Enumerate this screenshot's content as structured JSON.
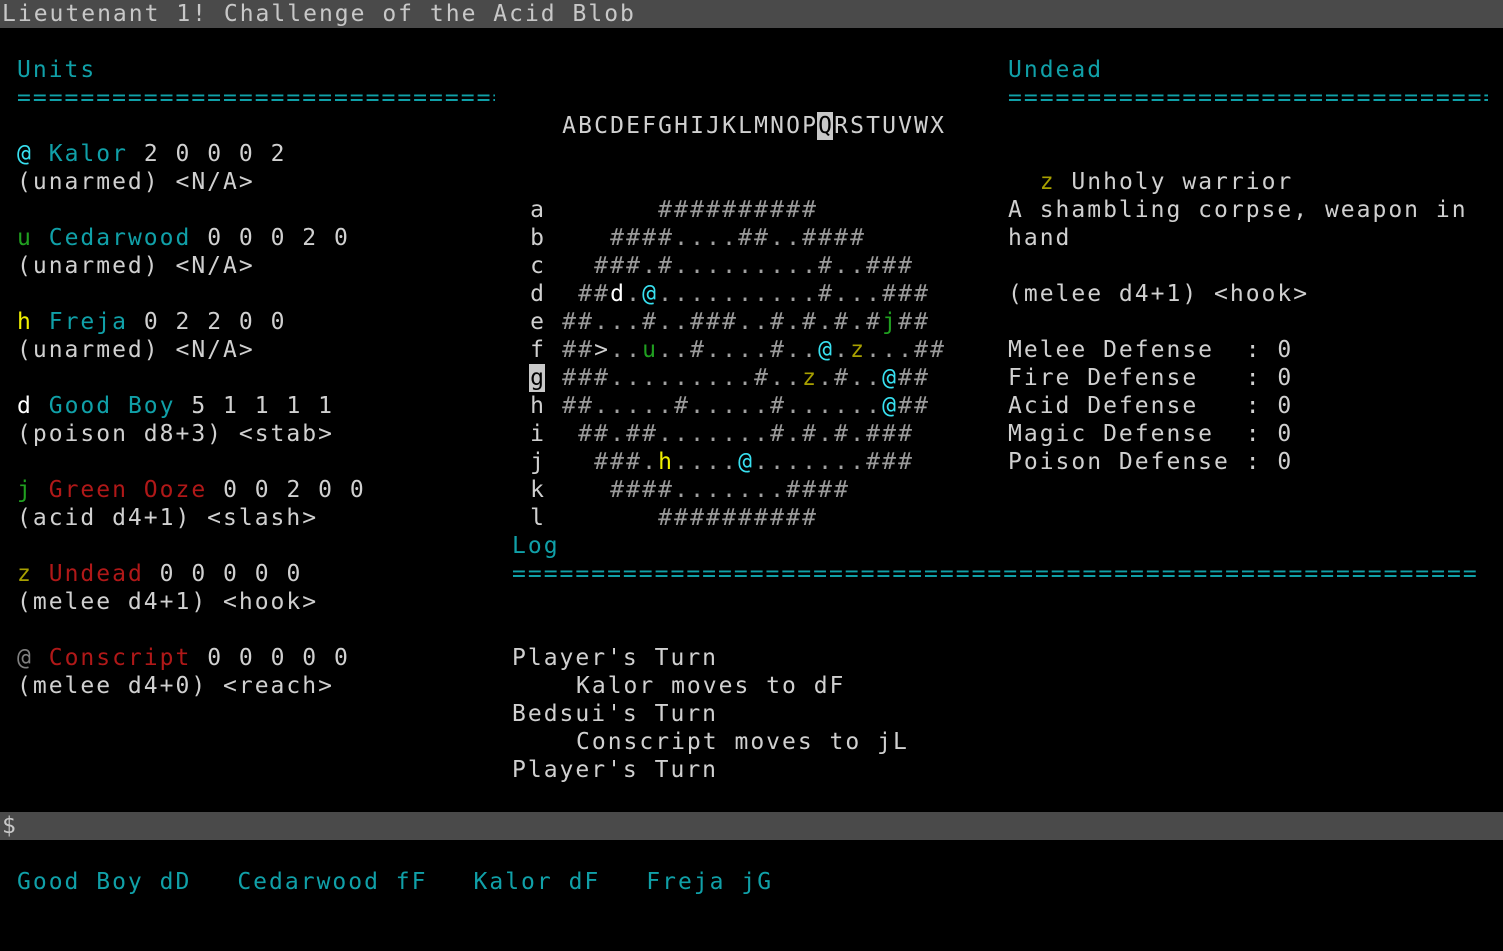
{
  "title": "Lieutenant 1! Challenge of the Acid Blob",
  "colors": {
    "teal": "#10a0a8",
    "cyan": "#38e0f0",
    "yellow": "#f0f000",
    "olive": "#a8a000",
    "green": "#20a020",
    "red": "#b01818",
    "gray": "#808080",
    "white": "#ffffff"
  },
  "units": {
    "heading": "Units",
    "rule": "===============================",
    "list": [
      {
        "glyph": "@",
        "glyph_color": "#38e0f0",
        "name": "Kalor",
        "name_color": "#10a0a8",
        "stats": "2 0 0 0 2",
        "weapon": "(unarmed) <N/A>"
      },
      {
        "glyph": "u",
        "glyph_color": "#20a020",
        "name": "Cedarwood",
        "name_color": "#10a0a8",
        "stats": "0 0 0 2 0",
        "weapon": "(unarmed) <N/A>"
      },
      {
        "glyph": "h",
        "glyph_color": "#f0f000",
        "name": "Freja",
        "name_color": "#10a0a8",
        "stats": "0 2 2 0 0",
        "weapon": "(unarmed) <N/A>"
      },
      {
        "glyph": "d",
        "glyph_color": "#ffffff",
        "name": "Good Boy",
        "name_color": "#10a0a8",
        "stats": "5 1 1 1 1",
        "weapon": "(poison d8+3) <stab>"
      },
      {
        "glyph": "j",
        "glyph_color": "#20a020",
        "name": "Green Ooze",
        "name_color": "#b01818",
        "stats": "0 0 2 0 0",
        "weapon": "(acid d4+1) <slash>"
      },
      {
        "glyph": "z",
        "glyph_color": "#a8a000",
        "name": "Undead",
        "name_color": "#b01818",
        "stats": "0 0 0 0 0",
        "weapon": "(melee d4+1) <hook>"
      },
      {
        "glyph": "@",
        "glyph_color": "#808080",
        "name": "Conscript",
        "name_color": "#b01818",
        "stats": "0 0 0 0 0",
        "weapon": "(melee d4+0) <reach>"
      }
    ]
  },
  "map": {
    "columns": [
      "A",
      "B",
      "C",
      "D",
      "E",
      "F",
      "G",
      "H",
      "I",
      "J",
      "K",
      "L",
      "M",
      "N",
      "O",
      "P",
      "Q",
      "R",
      "S",
      "T",
      "U",
      "V",
      "W",
      "X"
    ],
    "selected_column": "Q",
    "selected_row": "g",
    "rows": [
      {
        "label": "a",
        "cells": "      ##########      "
      },
      {
        "label": "b",
        "cells": "   ####....##..####   "
      },
      {
        "label": "c",
        "cells": "  ###.#.........#..###  "
      },
      {
        "label": "d",
        "cells": " ##d.@..........#...### "
      },
      {
        "label": "e",
        "cells": "##...#..###..#.#.#.#j##"
      },
      {
        "label": "f",
        "cells": "##>..u..#....#..@.z...##"
      },
      {
        "label": "g",
        "cells": "###.........#..z.#..@##"
      },
      {
        "label": "h",
        "cells": "##.....#.....#......@##"
      },
      {
        "label": "i",
        "cells": " ##.##.......#.#.#.### "
      },
      {
        "label": "j",
        "cells": "  ###.h....@.......###  "
      },
      {
        "label": "k",
        "cells": "   ####.......####   "
      },
      {
        "label": "l",
        "cells": "      ##########      "
      }
    ]
  },
  "inspect": {
    "heading": "Undead",
    "rule": "===============================",
    "glyph": "z",
    "name": "Unholy warrior",
    "desc_line1": "A shambling corpse, weapon in",
    "desc_line2": "hand",
    "attack": "(melee d4+1) <hook>",
    "defenses": [
      {
        "label": "Melee Defense  ",
        "value": "0"
      },
      {
        "label": "Fire Defense   ",
        "value": "0"
      },
      {
        "label": "Acid Defense   ",
        "value": "0"
      },
      {
        "label": "Magic Defense  ",
        "value": "0"
      },
      {
        "label": "Poison Defense ",
        "value": "0"
      }
    ]
  },
  "log": {
    "heading": "Log",
    "rule": "=============================================================",
    "lines": [
      {
        "text": "Player's Turn",
        "indent": false
      },
      {
        "text": "Kalor moves to dF",
        "indent": true
      },
      {
        "text": "Bedsui's Turn",
        "indent": false
      },
      {
        "text": "Conscript moves to jL",
        "indent": true
      },
      {
        "text": "Player's Turn",
        "indent": false
      }
    ]
  },
  "prompt": "$",
  "status": [
    {
      "name": "Good Boy",
      "pos": "dD"
    },
    {
      "name": "Cedarwood",
      "pos": "fF"
    },
    {
      "name": "Kalor",
      "pos": "dF"
    },
    {
      "name": "Freja",
      "pos": "jG"
    }
  ]
}
